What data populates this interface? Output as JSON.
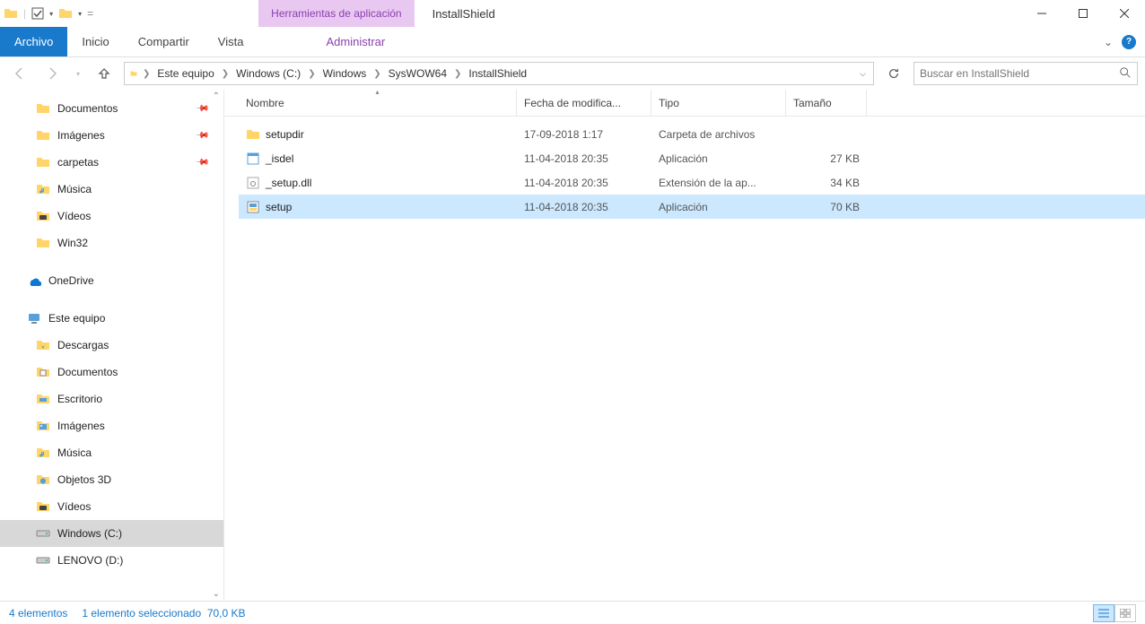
{
  "window": {
    "contextual_tab": "Herramientas de aplicación",
    "title": "InstallShield"
  },
  "ribbon": {
    "file": "Archivo",
    "tabs": [
      "Inicio",
      "Compartir",
      "Vista"
    ],
    "context": "Administrar"
  },
  "breadcrumb": [
    "Este equipo",
    "Windows (C:)",
    "Windows",
    "SysWOW64",
    "InstallShield"
  ],
  "search": {
    "placeholder": "Buscar en InstallShield"
  },
  "tree": {
    "items": [
      {
        "label": "Documentos",
        "icon": "folder",
        "pinned": true,
        "level": 1
      },
      {
        "label": "Imágenes",
        "icon": "folder",
        "pinned": true,
        "level": 1
      },
      {
        "label": "carpetas",
        "icon": "folder",
        "pinned": true,
        "level": 1
      },
      {
        "label": "Música",
        "icon": "folder-music",
        "level": 1
      },
      {
        "label": "Vídeos",
        "icon": "folder-video",
        "level": 1
      },
      {
        "label": "Win32",
        "icon": "folder",
        "level": 1
      },
      {
        "label": "",
        "spacer": true
      },
      {
        "label": "OneDrive",
        "icon": "onedrive",
        "level": 0
      },
      {
        "label": "",
        "spacer": true
      },
      {
        "label": "Este equipo",
        "icon": "this-pc",
        "level": 0
      },
      {
        "label": "Descargas",
        "icon": "folder-down",
        "level": 1
      },
      {
        "label": "Documentos",
        "icon": "folder-doc",
        "level": 1
      },
      {
        "label": "Escritorio",
        "icon": "folder-desk",
        "level": 1
      },
      {
        "label": "Imágenes",
        "icon": "folder-img",
        "level": 1
      },
      {
        "label": "Música",
        "icon": "folder-music",
        "level": 1
      },
      {
        "label": "Objetos 3D",
        "icon": "folder-3d",
        "level": 1
      },
      {
        "label": "Vídeos",
        "icon": "folder-video",
        "level": 1
      },
      {
        "label": "Windows (C:)",
        "icon": "drive",
        "level": 1,
        "selected": true
      },
      {
        "label": "LENOVO (D:)",
        "icon": "drive",
        "level": 1
      }
    ]
  },
  "columns": {
    "name": "Nombre",
    "date": "Fecha de modifica...",
    "type": "Tipo",
    "size": "Tamaño"
  },
  "files": [
    {
      "name": "setupdir",
      "date": "17-09-2018 1:17",
      "type": "Carpeta de archivos",
      "size": "",
      "icon": "folder"
    },
    {
      "name": "_isdel",
      "date": "11-04-2018 20:35",
      "type": "Aplicación",
      "size": "27 KB",
      "icon": "exe"
    },
    {
      "name": "_setup.dll",
      "date": "11-04-2018 20:35",
      "type": "Extensión de la ap...",
      "size": "34 KB",
      "icon": "dll"
    },
    {
      "name": "setup",
      "date": "11-04-2018 20:35",
      "type": "Aplicación",
      "size": "70 KB",
      "icon": "installer",
      "selected": true
    }
  ],
  "status": {
    "count": "4 elementos",
    "selection": "1 elemento seleccionado",
    "size": "70,0 KB"
  }
}
